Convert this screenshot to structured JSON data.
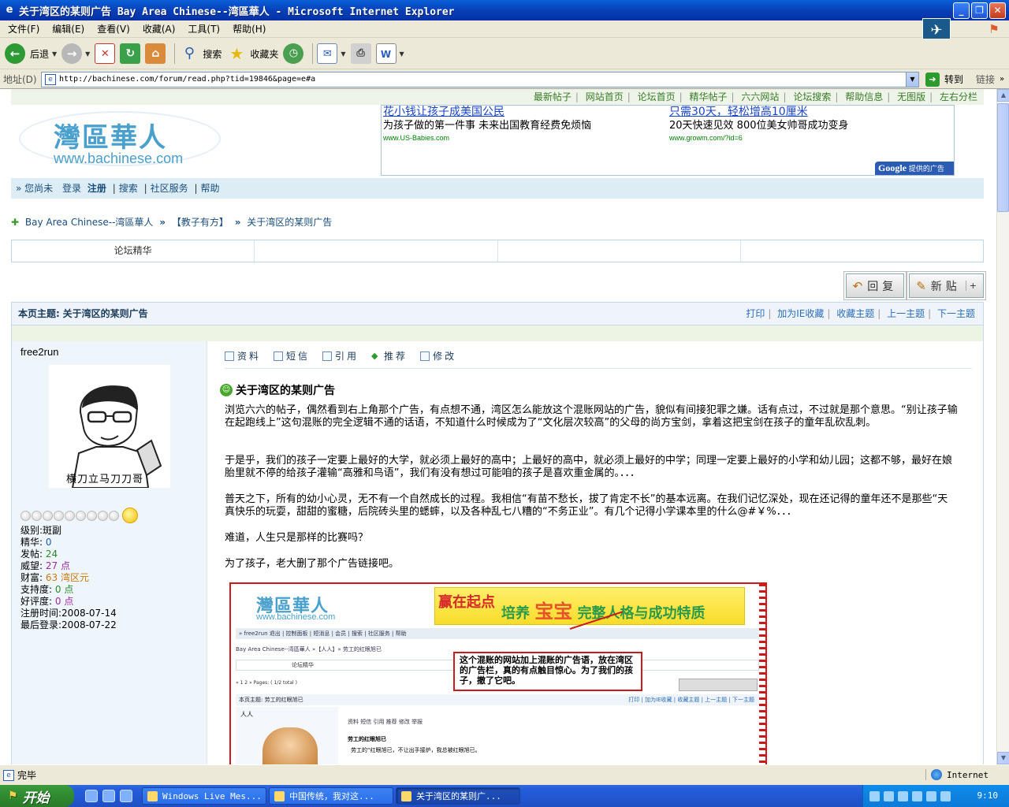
{
  "window": {
    "title": "关于湾区的某则广告 Bay Area Chinese--湾區華人 - Microsoft Internet Explorer"
  },
  "menu": {
    "items": [
      "文件(F)",
      "编辑(E)",
      "查看(V)",
      "收藏(A)",
      "工具(T)",
      "帮助(H)"
    ]
  },
  "toolbar": {
    "back_label": "后退",
    "search_label": "搜索",
    "favorites_label": "收藏夹"
  },
  "address": {
    "label": "地址(D)",
    "url": "http://bachinese.com/forum/read.php?tid=19846&page=e#a",
    "go_label": "转到",
    "links_label": "链接"
  },
  "site": {
    "top_links": [
      "最新帖子",
      "网站首页",
      "论坛首页",
      "精华帖子",
      "六六网站",
      "论坛搜索",
      "帮助信息",
      "无图版",
      "左右分栏"
    ],
    "logo_zh": "灣區華人",
    "logo_en": "www.bachinese.com",
    "ads": [
      {
        "title": "花小钱让孩子成美国公民",
        "desc": "为孩子做的第一件事 未来出国教育经费免烦恼",
        "url": "www.US-Babies.com"
      },
      {
        "title": "只需30天，轻松增高10厘米",
        "desc": "20天快速见效 800位美女帅哥成功变身",
        "url": "www.growm.com/?id=6"
      }
    ],
    "ad_badge_google": "Google",
    "ad_badge_text": "提供的广告",
    "userbar": {
      "prefix": "» 您尚未",
      "login": "登录",
      "register": "注册",
      "search": "搜索",
      "services": "社区服务",
      "help": "帮助"
    },
    "breadcrumb": {
      "home": "Bay Area Chinese--湾區華人",
      "forum": "【教子有方】",
      "topic": "关于湾区的某则广告"
    },
    "digest_row": [
      "论坛精华",
      "",
      "",
      ""
    ],
    "reply_label": "回复",
    "newpost_label": "新贴",
    "topic_header": {
      "label": "本页主题:",
      "title": "关于湾区的某则广告",
      "actions": [
        "打印",
        "加为IE收藏",
        "收藏主题",
        "上一主题",
        "下一主题"
      ]
    }
  },
  "post": {
    "author": "free2run",
    "avatar_caption": "横刀立马刀刀哥",
    "stats": [
      {
        "label": "级别:",
        "value": "斑副",
        "color": "default"
      },
      {
        "label": "精华:",
        "value": "0",
        "color": "blue"
      },
      {
        "label": "发帖:",
        "value": "24",
        "color": "green"
      },
      {
        "label": "威望:",
        "value": "27 点",
        "color": "purple"
      },
      {
        "label": "财富:",
        "value": "63 湾区元",
        "color": "orange"
      },
      {
        "label": "支持度:",
        "value": "0 点",
        "color": "green"
      },
      {
        "label": "好评度:",
        "value": "0 点",
        "color": "purple"
      },
      {
        "label": "注册时间:",
        "value": "2008-07-14",
        "color": "default"
      },
      {
        "label": "最后登录:",
        "value": "2008-07-22",
        "color": "default"
      }
    ],
    "tools": [
      "资料",
      "短信",
      "引用",
      "推荐",
      "修改"
    ],
    "title": "关于湾区的某则广告",
    "paragraphs": [
      "浏览六六的帖子，偶然看到右上角那个广告，有点想不通，湾区怎么能放这个混账网站的广告，貌似有间接犯罪之嫌。话有点过，不过就是那个意思。“别让孩子输在起跑线上”这句混账的完全逻辑不通的话语，不知道什么时候成为了“文化层次较高”的父母的尚方宝剑，拿着这把宝剑在孩子的童年乱砍乱刺。",
      "于是乎，我们的孩子一定要上最好的大学，就必须上最好的高中；上最好的高中，就必须上最好的中学；同理一定要上最好的小学和幼儿园；这都不够，最好在娘胎里就不停的给孩子灌输“高雅和鸟语”，我们有没有想过可能咱的孩子是喜欢重金属的。．．．",
      "普天之下，所有的幼小心灵，无不有一个自然成长的过程。我相信“有苗不愁长，拔了肯定不长”的基本远离。在我们记忆深处，现在还记得的童年还不是那些“天真快乐的玩耍，甜甜的蜜糖，后院砖头里的蟋蟀，以及各种乱七八糟的“不务正业”。有几个记得小学课本里的什么@#￥%．．．",
      "难道，人生只是那样的比赛吗？",
      "为了孩子，老大删了那个广告链接吧。"
    ],
    "embedded_image": {
      "logo_zh": "灣區華人",
      "logo_en": "www.bachinese.com",
      "banner_logo": "赢在起点",
      "banner_text_pre": "培养",
      "banner_text_em": "宝宝",
      "banner_text_post": "完整人格与成功特质",
      "nav": "» free2run 退出 | 控制面板 | 短消息 | 会员 | 搜索 | 社区服务 | 帮助",
      "crumb": "Bay Area Chinese--湾區華人 »【人人】» 劳工的红眼旭已",
      "row_label": "论坛精华",
      "pages": "« 1 2 » Pages: ( 1/2 total )",
      "head_label": "本页主题: 劳工的红眼旭已",
      "head_actions": "打印 | 加为IE收藏 | 收藏主题 | 上一主题 | 下一主题",
      "side_name": "人人",
      "tools": "资料  短信  引用  推荐  修改  举报",
      "ptitle": "劳工的红眼旭已",
      "ptext": "劳工的“红眼旭已，不让出手接炉，我总被红眼旭已。",
      "callout": "这个混账的网站加上混账的广告语，放在湾区的广告栏，真的有点触目惊心。为了我们的孩子，撤了它吧。"
    }
  },
  "statusbar": {
    "text": "完毕",
    "zone": "Internet"
  },
  "taskbar": {
    "start_label": "开始",
    "tasks": [
      {
        "label": "Windows Live Mes...",
        "active": false
      },
      {
        "label": "中国传统，我对这...",
        "active": false
      },
      {
        "label": "关于湾区的某则广...",
        "active": true
      }
    ],
    "clock": "9:10"
  }
}
